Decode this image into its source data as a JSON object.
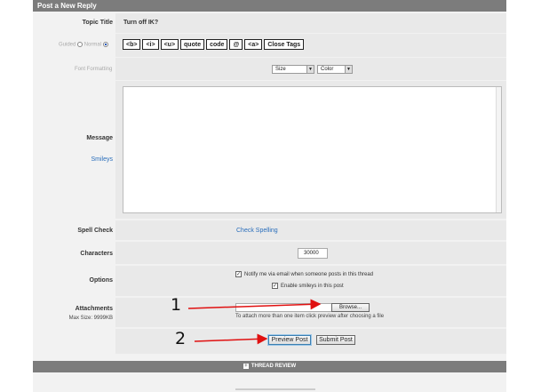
{
  "header": {
    "title": "Post a New Reply"
  },
  "topic": {
    "label": "Topic Title",
    "value": "Turn off IK?"
  },
  "mode": {
    "guided": "Guided",
    "normal": "Normal"
  },
  "tags": [
    "<b>",
    "<i>",
    "<u>",
    "quote",
    "code",
    "@",
    "<a>",
    "Close Tags"
  ],
  "font_formatting": {
    "label": "Font Formatting",
    "size": "Size",
    "color": "Color"
  },
  "message": {
    "label": "Message",
    "smileys": "Smileys"
  },
  "spell": {
    "label": "Spell Check",
    "link": "Check Spelling"
  },
  "characters": {
    "label": "Characters",
    "value": "30000"
  },
  "options": {
    "label": "Options",
    "notify": "Notify me via email when someone posts in this thread",
    "smilies": "Enable smileys in this post"
  },
  "attachments": {
    "label": "Attachments",
    "max": "Max Size: 9999KB",
    "browse": "Browse...",
    "hint": "To attach more than one item click preview after choosing a file"
  },
  "actions": {
    "preview": "Preview Post",
    "submit": "Submit Post"
  },
  "review": {
    "label": "THREAD REVIEW"
  },
  "annotations": {
    "one": "1",
    "two": "2"
  },
  "colors": {
    "header": "#7c7c7c",
    "link": "#2a6ebb",
    "arrow": "#e01010"
  }
}
